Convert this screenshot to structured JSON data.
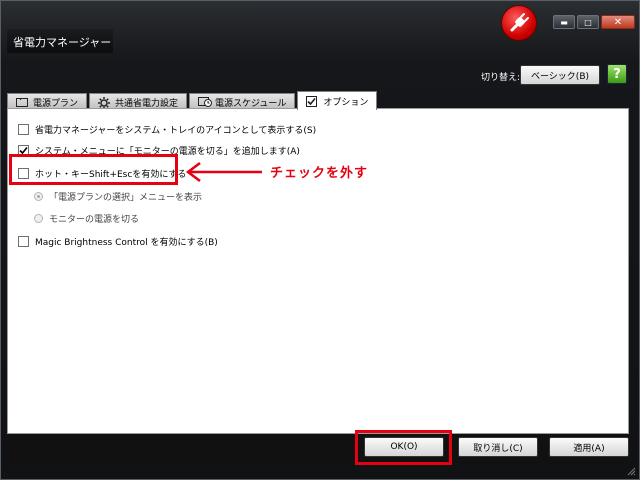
{
  "window": {
    "title": "省電力マネージャー",
    "minimize_glyph": "▬",
    "maximize_glyph": "□",
    "close_glyph": "✕"
  },
  "toolbar": {
    "switch_label": "切り替え:",
    "basic_button": "ベーシック(B)",
    "help_glyph": "?"
  },
  "tabs": [
    {
      "label": "電源プラン",
      "icon": "folder-icon"
    },
    {
      "label": "共通省電力設定",
      "icon": "gear-icon"
    },
    {
      "label": "電源スケジュール",
      "icon": "schedule-icon"
    },
    {
      "label": "オプション",
      "icon": "checkbox-icon",
      "active": true
    }
  ],
  "options": {
    "tray_icon": {
      "label": "省電力マネージャーをシステム・トレイのアイコンとして表示する(S)",
      "checked": false
    },
    "system_menu": {
      "label": "システム・メニューに「モニターの電源を切る」を追加します(A)",
      "checked": true
    },
    "hotkey": {
      "label": "ホット・キーShift+Escを有効にする",
      "checked": false
    },
    "radio_show_menu": {
      "label": "「電源プランの選択」メニューを表示",
      "selected": true
    },
    "radio_monitor_off": {
      "label": "モニターの電源を切る",
      "selected": false
    },
    "magic_brightness": {
      "label": "Magic Brightness Control を有効にする(B)",
      "checked": false
    }
  },
  "annotation": {
    "text": "チェックを外す",
    "color": "#e60012"
  },
  "buttons": {
    "ok": "OK(O)",
    "cancel": "取り消し(C)",
    "apply": "適用(A)"
  }
}
